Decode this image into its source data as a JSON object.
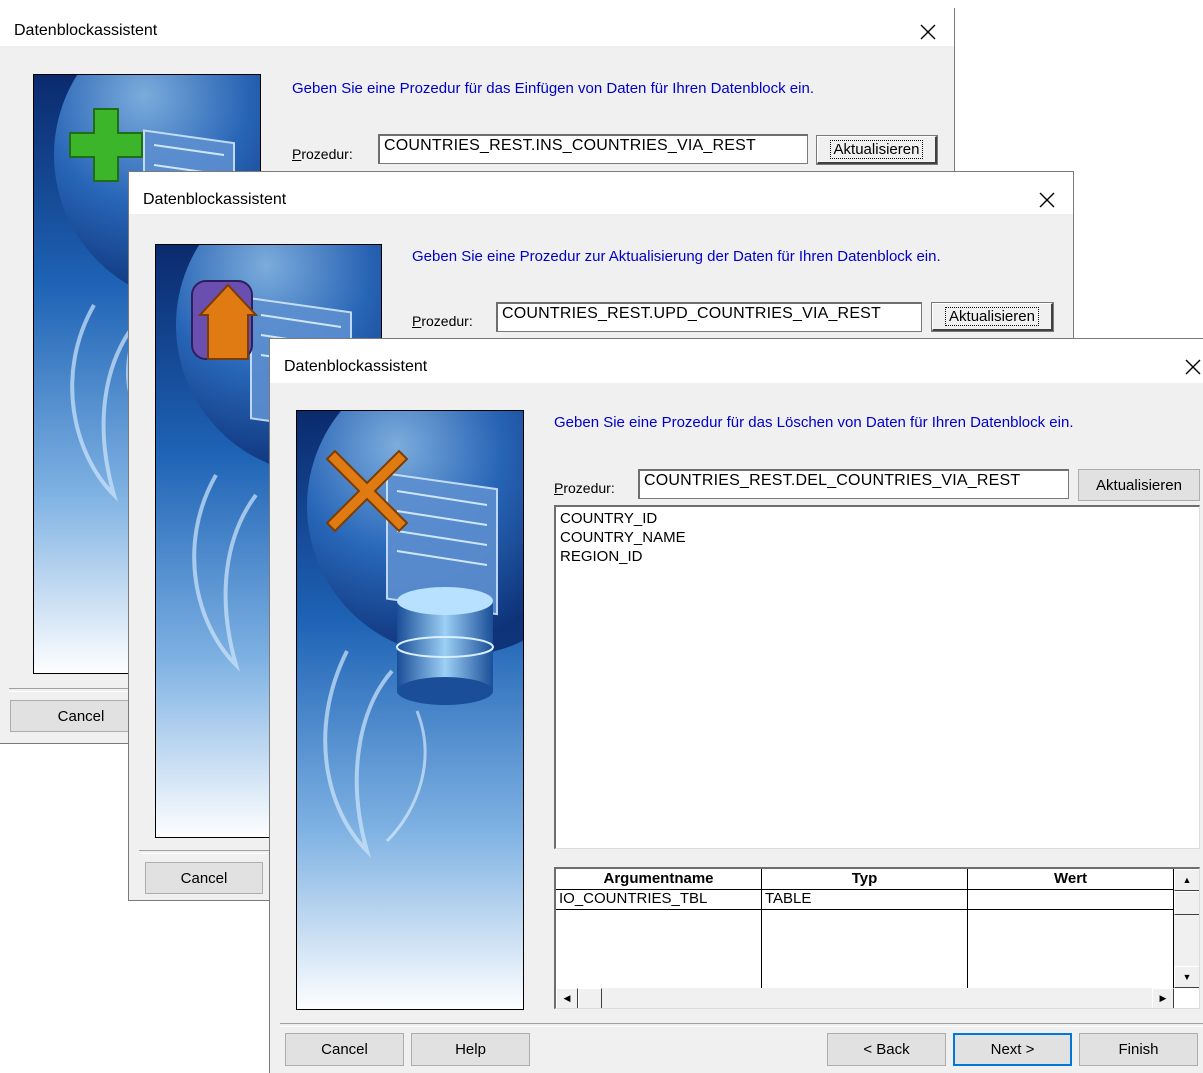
{
  "dialog_insert": {
    "title": "Datenblockassistent",
    "instruction": "Geben Sie eine Prozedur für das Einfügen von Daten für Ihren Datenblock ein.",
    "procedure_label": "Prozedur:",
    "procedure_value": "COUNTRIES_REST.INS_COUNTRIES_VIA_REST",
    "refresh_label": "Aktualisieren",
    "cancel_label": "Cancel",
    "icon": "green-plus-icon"
  },
  "dialog_update": {
    "title": "Datenblockassistent",
    "instruction": "Geben Sie eine Prozedur zur Aktualisierung der Daten für Ihren Datenblock ein.",
    "procedure_label": "Prozedur:",
    "procedure_value": "COUNTRIES_REST.UPD_COUNTRIES_VIA_REST",
    "refresh_label": "Aktualisieren",
    "cancel_label": "Cancel",
    "icon": "orange-update-arrow-icon"
  },
  "dialog_delete": {
    "title": "Datenblockassistent",
    "instruction": "Geben Sie eine Prozedur für das Löschen von Daten für Ihren Datenblock ein.",
    "procedure_label": "Prozedur:",
    "procedure_value": "COUNTRIES_REST.DEL_COUNTRIES_VIA_REST",
    "refresh_label": "Aktualisieren",
    "columns": [
      "COUNTRY_ID",
      "COUNTRY_NAME",
      "REGION_ID"
    ],
    "arguments_table": {
      "headers": [
        "Argumentname",
        "Typ",
        "Wert"
      ],
      "rows": [
        {
          "name": "IO_COUNTRIES_TBL",
          "type": "TABLE",
          "value": ""
        }
      ]
    },
    "buttons": {
      "cancel": "Cancel",
      "help": "Help",
      "back": "< Back",
      "next": "Next >",
      "finish": "Finish"
    },
    "icon": "orange-x-icon"
  },
  "colors": {
    "instruction_text": "#0000c8",
    "dialog_bg": "#f0f0f0",
    "plus_icon": "#3cb52a",
    "x_icon": "#e07a12",
    "update_icon_purple": "#6a4fb0",
    "update_icon_orange": "#e07a12"
  }
}
